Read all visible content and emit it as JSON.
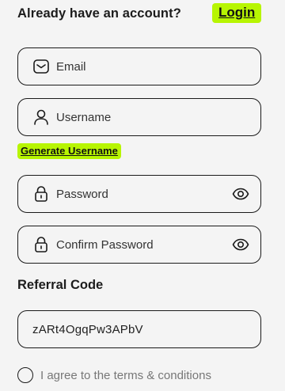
{
  "header": {
    "question": "Already have an account?",
    "login_label": "Login"
  },
  "form": {
    "email": {
      "placeholder": "Email",
      "icon": "mail-icon"
    },
    "username": {
      "placeholder": "Username",
      "icon": "user-icon"
    },
    "generate_username_label": "Generate Username",
    "password": {
      "placeholder": "Password",
      "icon": "lock-icon",
      "toggle_icon": "eye-icon"
    },
    "confirm_password": {
      "placeholder": "Confirm Password",
      "icon": "lock-icon",
      "toggle_icon": "eye-icon"
    },
    "referral_title": "Referral Code",
    "referral_value": "zARt4OgqPw3APbV",
    "terms_label": "I agree to the terms & conditions",
    "terms_checked": false
  },
  "colors": {
    "accent": "#b7f502",
    "background": "#f4f4f4",
    "border": "#1a1a1a"
  }
}
